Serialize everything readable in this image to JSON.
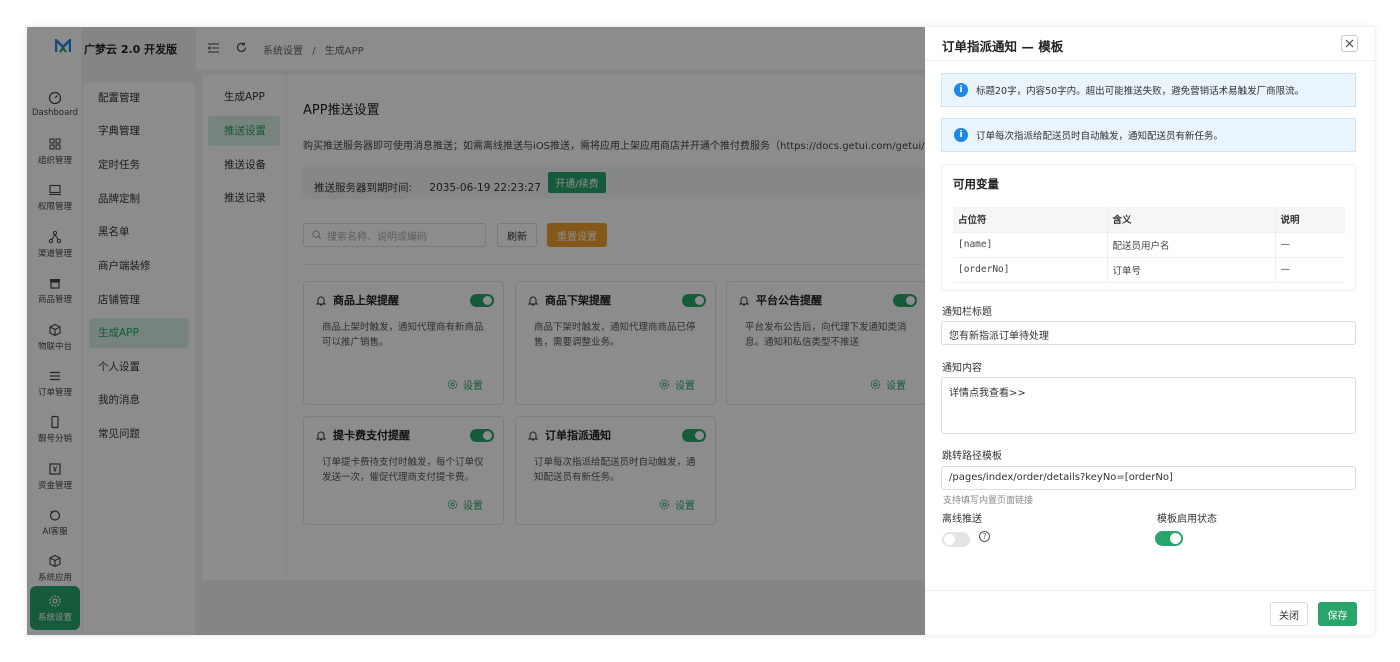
{
  "app": {
    "title": "广梦云 2.0 开发版"
  },
  "rail": [
    {
      "label": "Dashboard",
      "icon": "dashboard-icon"
    },
    {
      "label": "组织管理",
      "icon": "grid-icon"
    },
    {
      "label": "权限管理",
      "icon": "monitor-icon"
    },
    {
      "label": "渠道管理",
      "icon": "network-icon"
    },
    {
      "label": "商品管理",
      "icon": "store-icon"
    },
    {
      "label": "物联中台",
      "icon": "cube-icon"
    },
    {
      "label": "订单管理",
      "icon": "list-icon"
    },
    {
      "label": "靓号分销",
      "icon": "phone-icon"
    },
    {
      "label": "资金管理",
      "icon": "wallet-icon"
    },
    {
      "label": "AI客服",
      "icon": "robot-icon"
    },
    {
      "label": "系统应用",
      "icon": "box-icon"
    },
    {
      "label": "系统设置",
      "icon": "gear-icon"
    }
  ],
  "submenu": [
    "配置管理",
    "字典管理",
    "定时任务",
    "品牌定制",
    "黑名单",
    "商户端装修",
    "店铺管理",
    "生成APP",
    "个人设置",
    "我的消息",
    "常见问题"
  ],
  "breadcrumb": {
    "first": "系统设置",
    "sep": "/",
    "second": "生成APP"
  },
  "tabs": [
    "生成APP",
    "推送设置",
    "推送设备",
    "推送记录"
  ],
  "main": {
    "title": "APP推送设置",
    "desc": "购买推送服务器即可使用消息推送；如需离线推送与iOS推送，需将应用上架应用商店并开通个推付费服务（https://docs.getui.com/getui/billing/price/）",
    "expire_label": "推送服务器到期时间:",
    "expire_date": "2035-06-19 22:23:27",
    "renew_label": "开通/续费",
    "search_placeholder": "搜索名称、说明或编码",
    "refresh_label": "刷新",
    "reset_label": "重置设置"
  },
  "cards": [
    {
      "title": "商品上架提醒",
      "body": "商品上架时触发，通知代理商有新商品可以推广销售。",
      "setting": "设置",
      "enabled": true
    },
    {
      "title": "商品下架提醒",
      "body": "商品下架时触发，通知代理商商品已停售，需要调整业务。",
      "setting": "设置",
      "enabled": true
    },
    {
      "title": "平台公告提醒",
      "body": "平台发布公告后，向代理下发通知类消息。通知和私信类型不推送",
      "setting": "设置",
      "enabled": true
    },
    {
      "title": "提卡费支付提醒",
      "body": "订单提卡费待支付时触发，每个订单仅发送一次，催促代理商支付提卡费。",
      "setting": "设置",
      "enabled": true
    },
    {
      "title": "订单指派通知",
      "body": "订单每次指派给配送员时自动触发，通知配送员有新任务。",
      "setting": "设置",
      "enabled": true
    }
  ],
  "drawer": {
    "title": "订单指派通知 — 模板",
    "alert1": "标题20字，内容50字内。超出可能推送失败，避免营销话术易触发厂商限流。",
    "alert2": "订单每次指派给配送员时自动触发，通知配送员有新任务。",
    "vars_title": "可用变量",
    "vars_headers": [
      "占位符",
      "含义",
      "说明"
    ],
    "vars_rows": [
      [
        "[name]",
        "配送员用户名",
        "—"
      ],
      [
        "[orderNo]",
        "订单号",
        "—"
      ]
    ],
    "notify_title_label": "通知栏标题",
    "notify_title_value": "您有新指派订单待处理",
    "notify_content_label": "通知内容",
    "notify_content_value": "详情点我查看>>",
    "path_label": "跳转路径模板",
    "path_value": "/pages/index/order/details?keyNo=[orderNo]",
    "path_hint": "支持填写内置页面链接",
    "offline_label": "离线推送",
    "offline_enabled": false,
    "template_status_label": "模板启用状态",
    "template_enabled": true,
    "close_label": "关闭",
    "save_label": "保存"
  },
  "colors": {
    "accent": "#27a56a",
    "warning": "#f0a02e",
    "info": "#1f88e5"
  }
}
